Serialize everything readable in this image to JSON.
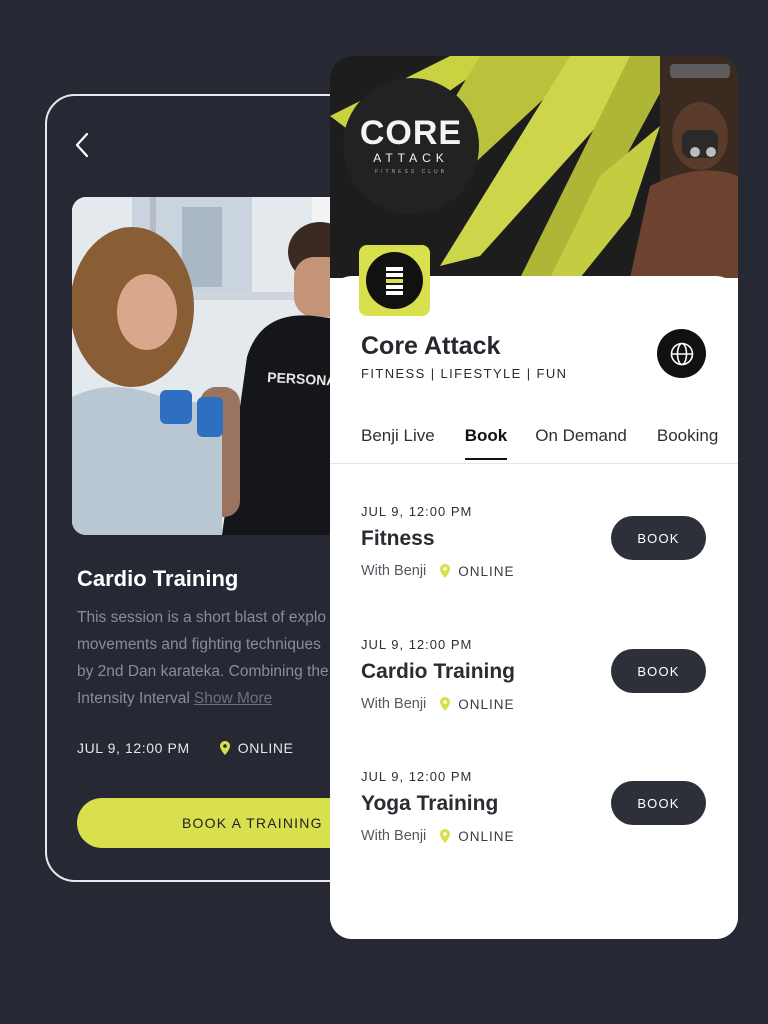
{
  "detail": {
    "title": "Cardio Training",
    "description_lines": [
      "This session is a short blast of explo",
      "movements and fighting techniques",
      "by 2nd Dan karateka. Combining the",
      "Intensity Interval"
    ],
    "show_more": "Show More",
    "date": "JUL 9, 12:00 PM",
    "location": "ONLINE",
    "cta": "BOOK A TRAINING",
    "photo_text": "PERSONAL T"
  },
  "club": {
    "logo_line1": "CORE",
    "logo_line2": "ATTACK",
    "logo_line3": "FITNESS CLUB",
    "name": "Core Attack",
    "tags": "FITNESS | LIFESTYLE | FUN",
    "tabs": [
      {
        "label": "Benji Live",
        "active": false
      },
      {
        "label": "Book",
        "active": true
      },
      {
        "label": "On Demand",
        "active": false
      },
      {
        "label": "Booking",
        "active": false
      }
    ]
  },
  "classes": [
    {
      "date": "JUL 9, 12:00 PM",
      "name": "Fitness",
      "instructor": "With Benji",
      "location": "ONLINE",
      "button": "BOOK"
    },
    {
      "date": "JUL 9, 12:00 PM",
      "name": "Cardio Training",
      "instructor": "With Benji",
      "location": "ONLINE",
      "button": "BOOK"
    },
    {
      "date": "JUL 9, 12:00 PM",
      "name": "Yoga Training",
      "instructor": "With Benji",
      "location": "ONLINE",
      "button": "BOOK"
    }
  ],
  "colors": {
    "background": "#262933",
    "accent": "#d8e04d",
    "button_dark": "#2e3039"
  }
}
